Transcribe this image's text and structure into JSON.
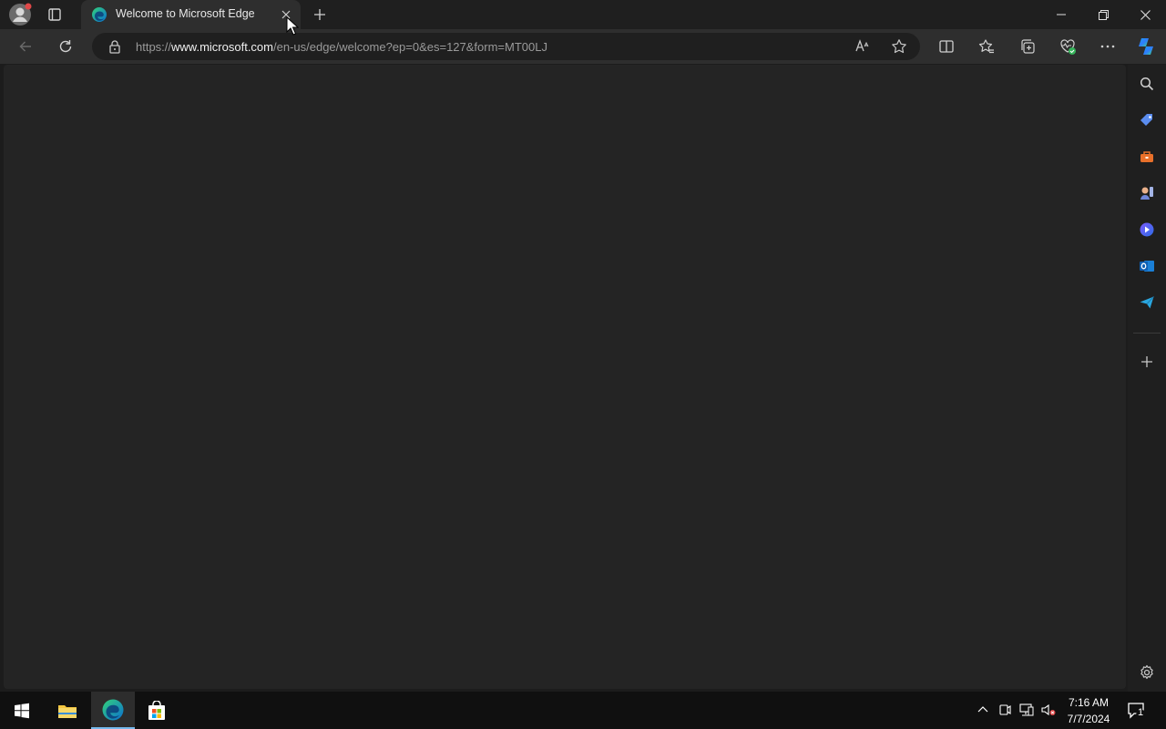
{
  "browser": {
    "tab": {
      "title": "Welcome to Microsoft Edge"
    },
    "address": {
      "scheme": "https://",
      "host": "www.microsoft.com",
      "path": "/en-us/edge/welcome?ep=0&es=127&form=MT00LJ"
    },
    "icons": {
      "profile": "profile-icon",
      "tab_actions": "tab-actions-icon",
      "new_tab": "plus-icon",
      "back": "back-arrow-icon",
      "refresh": "refresh-icon",
      "lock": "lock-icon",
      "read_aloud": "read-aloud-icon",
      "favorite": "star-icon",
      "split_screen": "split-screen-icon",
      "favorites": "favorites-icon",
      "collections": "collections-icon",
      "browser_essentials": "browser-essentials-icon",
      "more": "more-icon",
      "copilot": "copilot-icon"
    }
  },
  "sidebar": {
    "items": [
      "search-icon",
      "shopping-tag-icon",
      "tools-icon",
      "games-icon",
      "copilot-icon",
      "outlook-icon",
      "drop-icon",
      "add-icon",
      "settings-icon"
    ]
  },
  "taskbar": {
    "time": "7:16 AM",
    "date": "7/7/2024",
    "notification_count": "1",
    "apps": [
      "windows-start-icon",
      "file-explorer-icon",
      "edge-icon",
      "microsoft-store-icon"
    ]
  },
  "colors": {
    "accent": "#76b9ed",
    "content_bg": "#242424",
    "toolbar_bg": "#2e2e2e"
  }
}
